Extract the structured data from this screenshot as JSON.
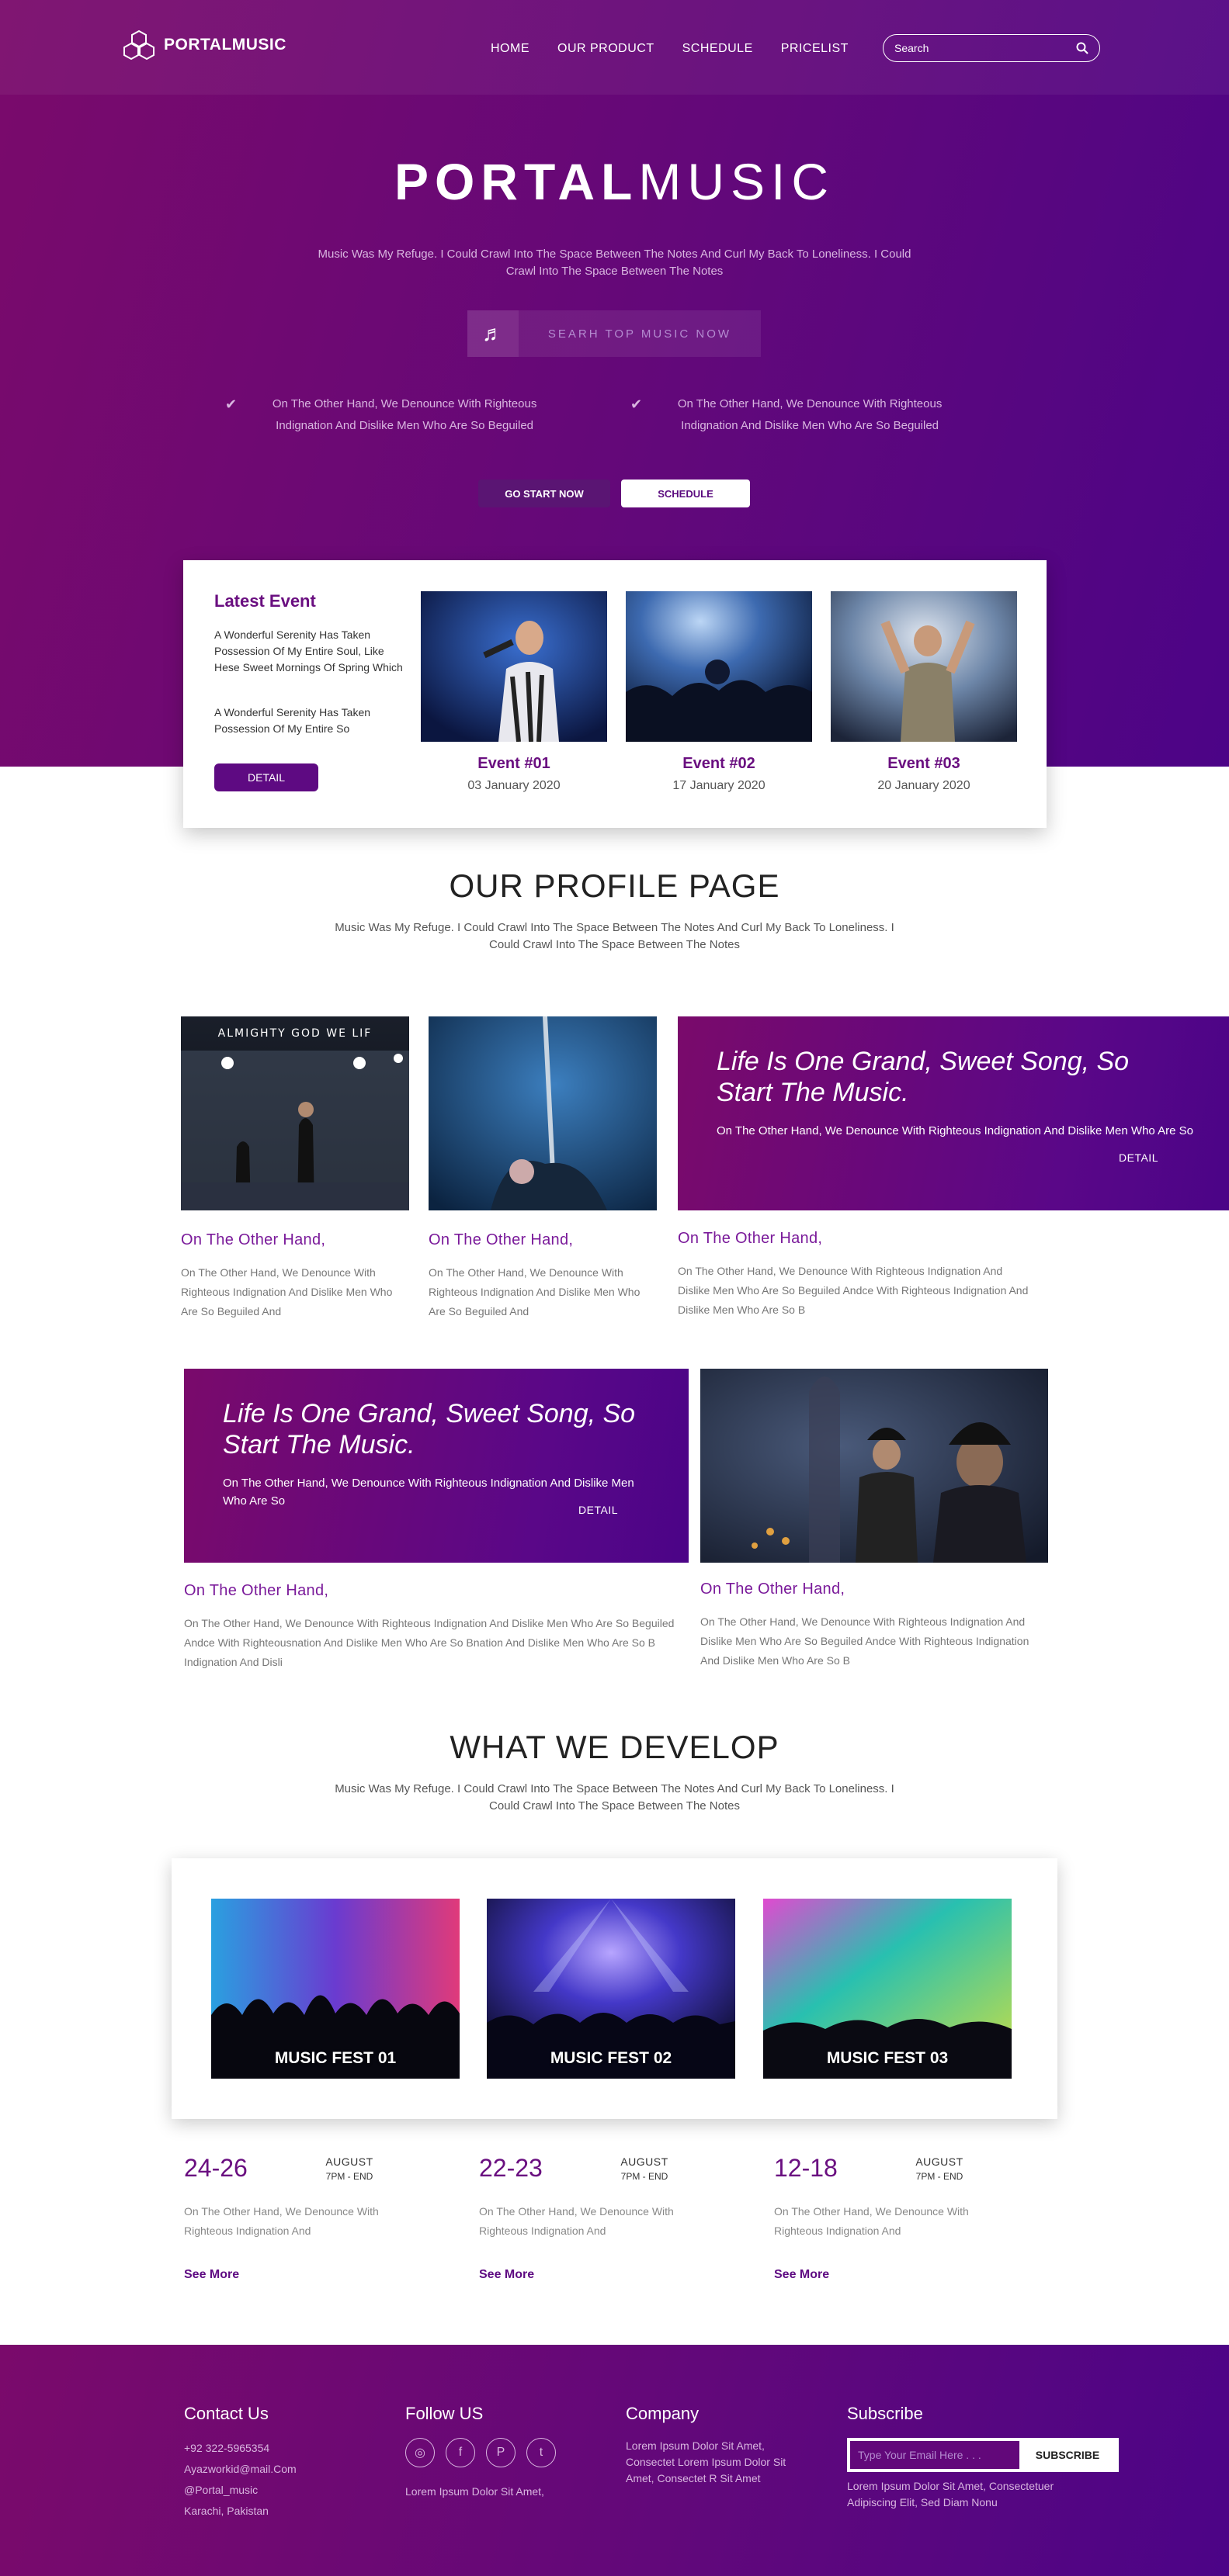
{
  "header": {
    "logo": "PORTALMUSIC",
    "nav": [
      "HOME",
      "OUR PRODUCT",
      "SCHEDULE",
      "PRICELIST"
    ],
    "search_placeholder": "Search"
  },
  "hero": {
    "title_bold": "PORTAL",
    "title_light": "MUSIC",
    "subtitle": "Music Was My Refuge. I Could Crawl Into The Space Between The Notes And Curl My Back To Loneliness. I Could Crawl Into The Space Between The Notes",
    "search_music": "SEARH TOP MUSIC NOW",
    "checks": [
      "On The Other Hand, We Denounce With Righteous Indignation And Dislike Men Who Are So Beguiled",
      "On The Other Hand, We Denounce With Righteous Indignation And Dislike Men Who Are So Beguiled"
    ],
    "go_button": "GO START NOW",
    "schedule_button": "SCHEDULE"
  },
  "latest_event": {
    "title": "Latest Event",
    "text1": "A Wonderful Serenity Has Taken Possession Of My Entire Soul, Like Hese Sweet Mornings Of Spring Which",
    "text2": "A Wonderful Serenity Has Taken Possession Of My Entire So",
    "detail_button": "DETAIL",
    "events": [
      {
        "name": "Event #01",
        "date": "03 January 2020"
      },
      {
        "name": "Event #02",
        "date": "17 January 2020"
      },
      {
        "name": "Event #03",
        "date": "20 January 2020"
      }
    ]
  },
  "profile": {
    "title": "OUR PROFILE PAGE",
    "subtitle": "Music Was My Refuge. I Could Crawl Into The Space Between The Notes And Curl My Back To Loneliness. I Could Crawl Into The Space Between The Notes",
    "photo_caption": "ALMIGHTY GOD WE LIF",
    "promo_big": "Life Is One Grand, Sweet Song, So Start The Music.",
    "promo_small": "On The Other Hand, We Denounce With Righteous Indignation And Dislike Men Who Are So",
    "promo_detail": "DETAIL",
    "row1": [
      {
        "head": "On The Other Hand,",
        "text": "On The Other Hand, We Denounce With Righteous Indignation And Dislike Men Who Are So Beguiled And"
      },
      {
        "head": "On The Other Hand,",
        "text": "On The Other Hand, We Denounce With Righteous Indignation And Dislike Men Who Are So Beguiled And"
      },
      {
        "head": "On The Other Hand,",
        "text": "On The Other Hand, We Denounce With Righteous Indignation And Dislike Men Who Are So Beguiled Andce With Righteous Indignation And Dislike Men Who Are So B"
      }
    ],
    "row2": [
      {
        "head": "On The Other Hand,",
        "text": "On The Other Hand, We Denounce With Righteous Indignation And Dislike Men Who Are So Beguiled Andce With Righteousnation And Dislike Men Who Are So Bnation And Dislike Men Who Are So B Indignation And Disli"
      },
      {
        "head": "On The Other Hand,",
        "text": "On The Other Hand, We Denounce With Righteous Indignation And Dislike Men Who Are So Beguiled Andce With Righteous Indignation And Dislike Men Who Are So B"
      }
    ]
  },
  "develop": {
    "title": "WHAT WE DEVELOP",
    "subtitle": "Music Was My Refuge. I Could Crawl Into The Space Between The Notes And Curl My Back To Loneliness. I Could Crawl Into The Space Between The Notes",
    "fests": [
      "MUSIC FEST 01",
      "MUSIC FEST 02",
      "MUSIC FEST 03"
    ],
    "dates": [
      {
        "range": "24-26",
        "month": "AUGUST",
        "time": "7PM - END",
        "desc": "On The Other Hand, We Denounce With Righteous Indignation And",
        "more": "See More"
      },
      {
        "range": "22-23",
        "month": "AUGUST",
        "time": "7PM - END",
        "desc": "On The Other Hand, We Denounce With Righteous Indignation And",
        "more": "See More"
      },
      {
        "range": "12-18",
        "month": "AUGUST",
        "time": "7PM - END",
        "desc": "On The Other Hand, We Denounce With Righteous Indignation And",
        "more": "See More"
      }
    ]
  },
  "footer": {
    "contact": {
      "title": "Contact Us",
      "lines": [
        "+92 322-5965354",
        "Ayazworkid@mail.Com",
        "@Portal_music",
        "Karachi, Pakistan"
      ]
    },
    "follow": {
      "title": "Follow US",
      "icons": [
        "instagram-icon",
        "facebook-icon",
        "pinterest-icon",
        "twitter-icon"
      ],
      "text": "Lorem Ipsum Dolor Sit Amet,"
    },
    "company": {
      "title": "Company",
      "text": "Lorem Ipsum Dolor Sit Amet, Consectet Lorem Ipsum Dolor Sit Amet, Consectet R Sit Amet"
    },
    "subscribe": {
      "title": "Subscribe",
      "placeholder": "Type Your Email Here . . .",
      "button": "SUBSCRIBE",
      "text": "Lorem Ipsum Dolor Sit Amet, Consectetuer Adipiscing Elit, Sed Diam Nonu"
    }
  }
}
